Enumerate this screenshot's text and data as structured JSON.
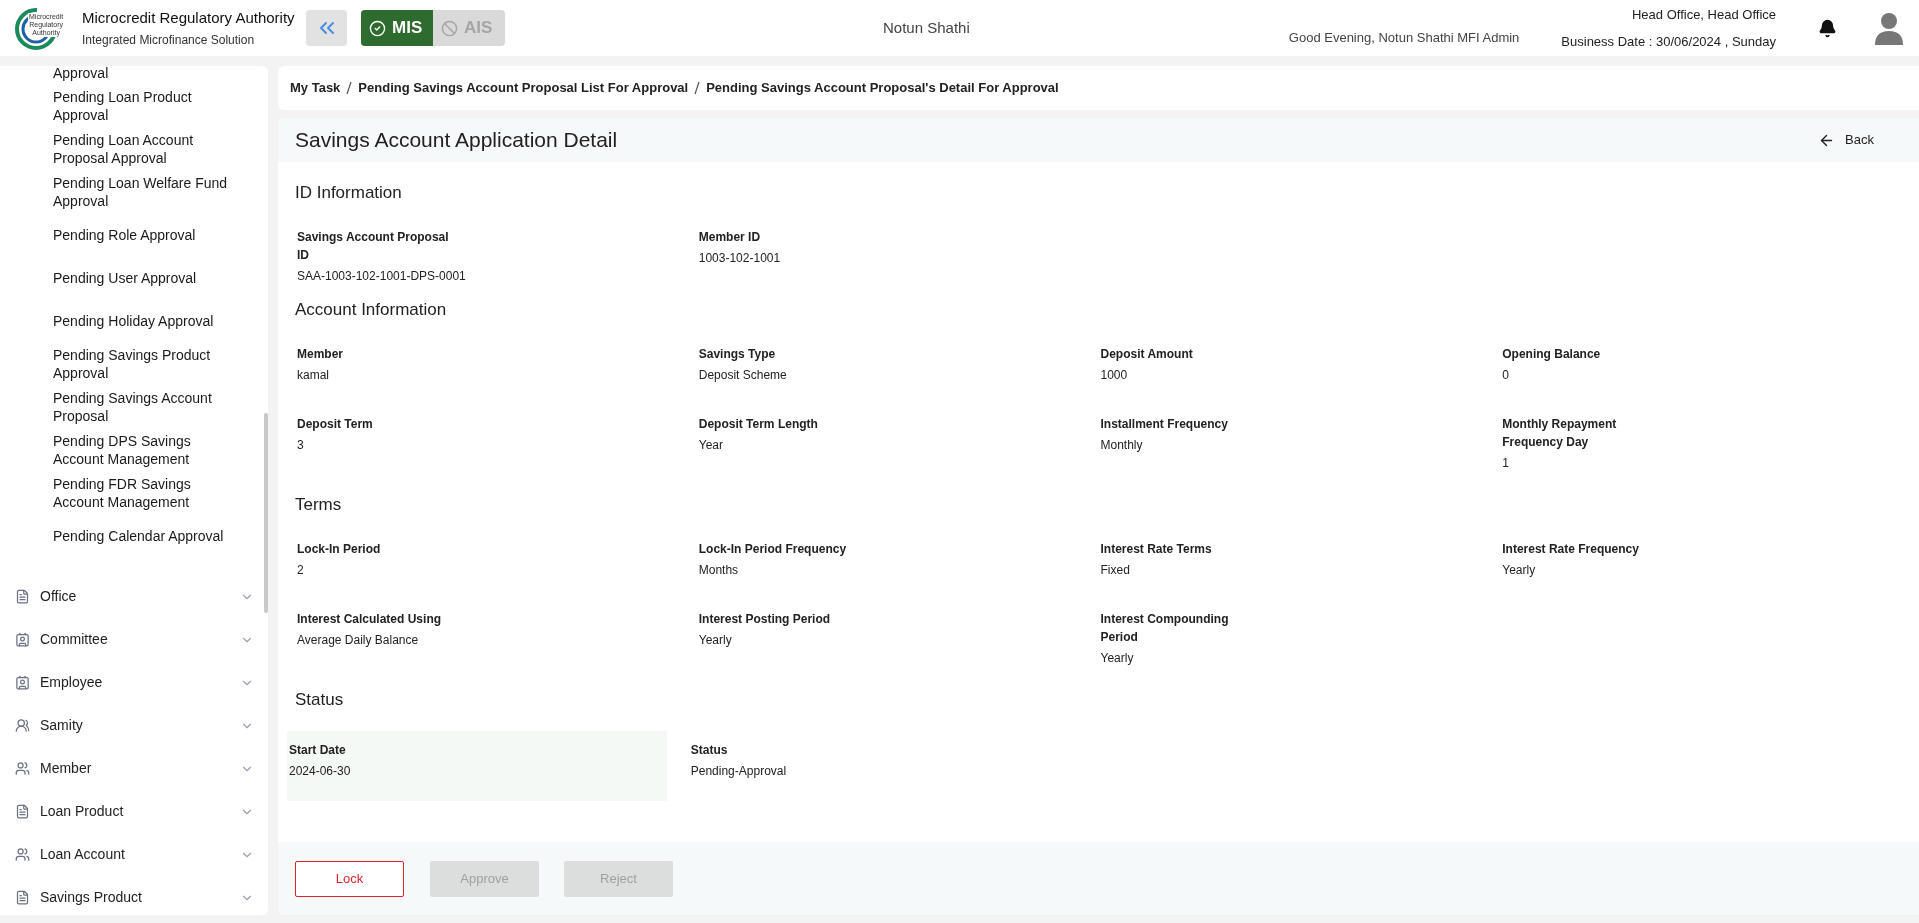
{
  "header": {
    "logo_text": [
      "Microcredit",
      "Regulatory",
      "Authority"
    ],
    "org_name": "Microcredit Regulatory Authority",
    "org_subtitle": "Integrated Microfinance Solution",
    "modules": [
      {
        "label": "MIS",
        "selected": true
      },
      {
        "label": "AIS",
        "selected": false
      }
    ],
    "center_title": "Notun Shathi",
    "greeting": "Good Evening, Notun Shathi MFI Admin",
    "office": "Head Office, Head Office",
    "business_date": "Business Date : 30/06/2024 , Sunday"
  },
  "sidebar": {
    "sub_items": [
      "Approval",
      "Pending Loan Product Approval",
      "Pending Loan Account Proposal Approval",
      "Pending Loan Welfare Fund Approval",
      "Pending Role Approval",
      "Pending User Approval",
      "Pending Holiday Approval",
      "Pending Savings Product Approval",
      "Pending Savings Account Proposal",
      "Pending DPS Savings Account Management",
      "Pending FDR Savings Account Management",
      "Pending Calendar Approval"
    ],
    "menus": [
      {
        "label": "Office",
        "kind": "document"
      },
      {
        "label": "Committee",
        "kind": "badge"
      },
      {
        "label": "Employee",
        "kind": "badge"
      },
      {
        "label": "Samity",
        "kind": "group"
      },
      {
        "label": "Member",
        "kind": "people"
      },
      {
        "label": "Loan Product",
        "kind": "document"
      },
      {
        "label": "Loan Account",
        "kind": "people"
      },
      {
        "label": "Savings Product",
        "kind": "document"
      }
    ]
  },
  "breadcrumb": [
    "My Task",
    "Pending Savings Account Proposal List For Approval",
    "Pending Savings Account Proposal's Detail For Approval"
  ],
  "page": {
    "title": "Savings Account Application Detail",
    "back": "Back",
    "sections": [
      {
        "title": "ID Information",
        "fields": [
          {
            "label": "Savings Account Proposal ID",
            "value": "SAA-1003-102-1001-DPS-0001",
            "highlighted": false
          },
          {
            "label": "Member ID",
            "value": "1003-102-1001",
            "highlighted": false
          }
        ]
      },
      {
        "title": "Account Information",
        "fields": [
          {
            "label": "Member",
            "value": "kamal",
            "highlighted": false
          },
          {
            "label": "Savings Type",
            "value": "Deposit Scheme",
            "highlighted": false
          },
          {
            "label": "Deposit Amount",
            "value": "1000",
            "highlighted": false
          },
          {
            "label": "Opening Balance",
            "value": "0",
            "highlighted": false
          },
          {
            "label": "Deposit Term",
            "value": "3",
            "highlighted": false
          },
          {
            "label": "Deposit Term Length",
            "value": "Year",
            "highlighted": false
          },
          {
            "label": "Installment Frequency",
            "value": "Monthly",
            "highlighted": false
          },
          {
            "label": "Monthly Repayment Frequency Day",
            "value": "1",
            "highlighted": false
          }
        ]
      },
      {
        "title": "Terms",
        "fields": [
          {
            "label": "Lock-In Period",
            "value": "2",
            "highlighted": false
          },
          {
            "label": "Lock-In Period Frequency",
            "value": "Months",
            "highlighted": false
          },
          {
            "label": "Interest Rate Terms",
            "value": "Fixed",
            "highlighted": false
          },
          {
            "label": "Interest Rate Frequency",
            "value": "Yearly",
            "highlighted": false
          },
          {
            "label": "Interest Calculated Using",
            "value": "Average Daily Balance",
            "highlighted": false
          },
          {
            "label": "Interest Posting Period",
            "value": "Yearly",
            "highlighted": false
          },
          {
            "label": "Interest Compounding Period",
            "value": "Yearly",
            "highlighted": false
          }
        ]
      },
      {
        "title": "Status",
        "fields": [
          {
            "label": "Start Date",
            "value": "2024-06-30",
            "highlighted": true
          },
          {
            "label": "Status",
            "value": "Pending-Approval",
            "highlighted": false
          }
        ]
      }
    ],
    "actions": [
      {
        "label": "Lock",
        "kind": "outline",
        "disabled": false
      },
      {
        "label": "Approve",
        "kind": "solid",
        "disabled": true
      },
      {
        "label": "Reject",
        "kind": "solid",
        "disabled": true
      }
    ]
  }
}
